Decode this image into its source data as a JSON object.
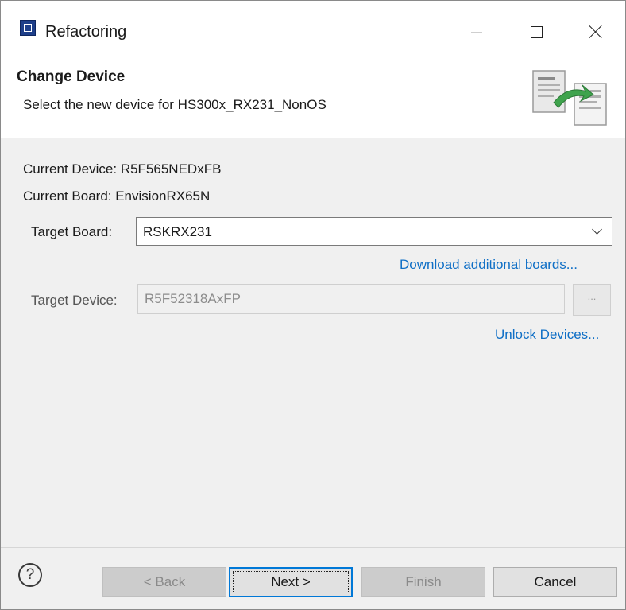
{
  "window": {
    "title": "Refactoring",
    "icon": "refactoring-app-icon"
  },
  "header": {
    "title": "Change Device",
    "subtitle": "Select the new device for HS300x_RX231_NonOS",
    "graphic": "wizard-banner-icon"
  },
  "current": {
    "device": "Current Device: R5F565NEDxFB",
    "board": "Current Board: EnvisionRX65N"
  },
  "target_board": {
    "label": "Target Board:",
    "value": "RSKRX231",
    "link": "Download additional boards..."
  },
  "target_device": {
    "label": "Target Device:",
    "value": "R5F52318AxFP",
    "browse_label": "...",
    "link": "Unlock Devices..."
  },
  "buttons": {
    "back": "< Back",
    "next": "Next >",
    "finish": "Finish",
    "cancel": "Cancel"
  },
  "colors": {
    "link": "#0f6fc6",
    "default_button_border": "#0078d7",
    "dialog_background": "#f0f0f0"
  }
}
